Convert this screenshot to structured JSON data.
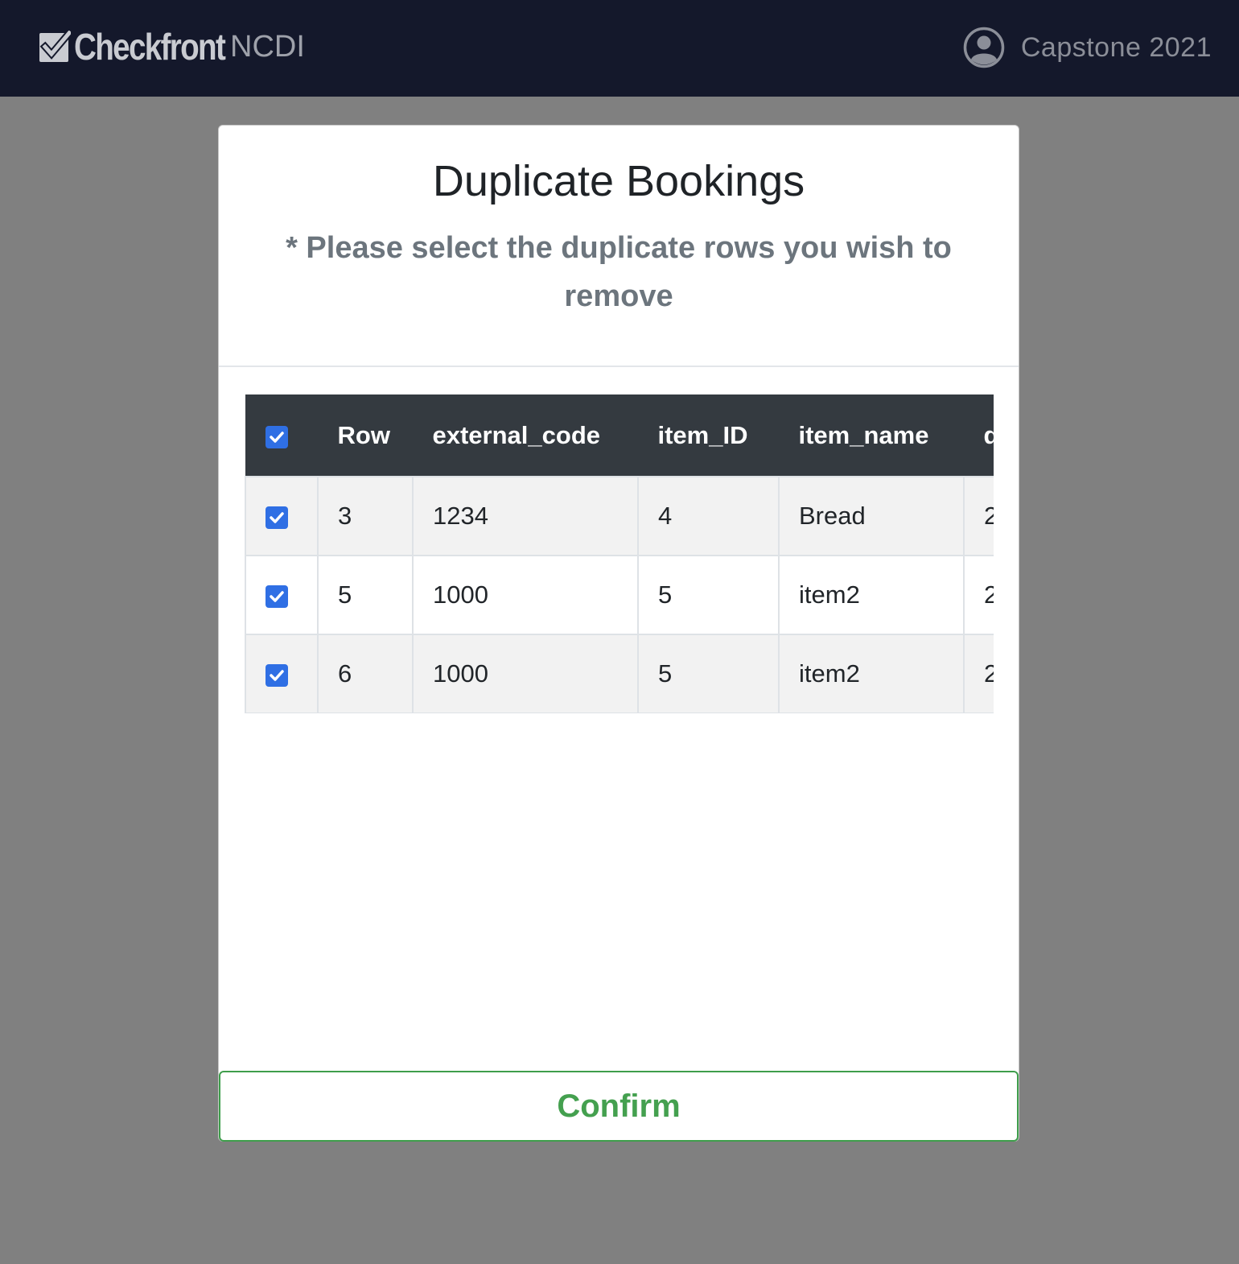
{
  "navbar": {
    "brand_name": "Checkfront",
    "org_name": "NCDI",
    "user_name": "Capstone 2021"
  },
  "modal": {
    "title": "Duplicate Bookings",
    "subtitle": "* Please select the duplicate rows you wish to remove",
    "confirm_label": "Confirm"
  },
  "table": {
    "select_all_checked": true,
    "columns": [
      "Row",
      "external_code",
      "item_ID",
      "item_name",
      "d"
    ],
    "rows": [
      {
        "checked": true,
        "cells": [
          "3",
          "1234",
          "4",
          "Bread",
          "2"
        ]
      },
      {
        "checked": true,
        "cells": [
          "5",
          "1000",
          "5",
          "item2",
          "2"
        ]
      },
      {
        "checked": true,
        "cells": [
          "6",
          "1000",
          "5",
          "item2",
          "2"
        ]
      }
    ]
  },
  "colors": {
    "navbar_bg": "#14182b",
    "overlay_bg": "#808080",
    "table_header_bg": "#343a40",
    "checkbox_blue": "#2f6fe4",
    "confirm_green": "#44a04f"
  },
  "icons": {
    "brand": "checkbox-check-icon",
    "user": "user-circle-icon",
    "checkbox": "checkmark-icon"
  }
}
